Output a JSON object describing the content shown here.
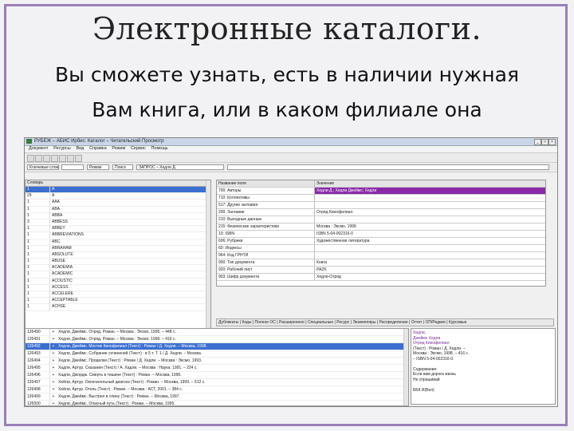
{
  "slide": {
    "title": "Электронные каталоги.",
    "subtitle": "Вы сможете узнать, есть в наличии нужная Вам книга, или в каком филиале она находится."
  },
  "app": {
    "window_title": "РУБЕЖ – АБИС Ирбис: Каталог – Читательский Просмотр",
    "menu": [
      "Документ",
      "Ресурсы",
      "Вид",
      "Справка",
      "Режим",
      "Сервис",
      "Помощь"
    ],
    "search": {
      "field1": "Ключевые слова",
      "field2": "",
      "field3": "Режим",
      "field4": "Поиск",
      "field5": "ЗАПРОС – Хедли Д.",
      "field6": ""
    },
    "left_list": {
      "header_term": "Словарь",
      "rows": [
        {
          "n": "1",
          "t": "A",
          "selected": true
        },
        {
          "n": "29",
          "t": "A"
        },
        {
          "n": "1",
          "t": "AAA"
        },
        {
          "n": "1",
          "t": "ABA"
        },
        {
          "n": "1",
          "t": "ABBA"
        },
        {
          "n": "3",
          "t": "ABBESS"
        },
        {
          "n": "1",
          "t": "ABBEY"
        },
        {
          "n": "1",
          "t": "ABBREVIATIONS"
        },
        {
          "n": "1",
          "t": "ABC"
        },
        {
          "n": "1",
          "t": "ABRAHAM"
        },
        {
          "n": "1",
          "t": "ABSOLUTE"
        },
        {
          "n": "1",
          "t": "ABUSE"
        },
        {
          "n": "1",
          "t": "ACADEMIA"
        },
        {
          "n": "1",
          "t": "ACADEMIC"
        },
        {
          "n": "1",
          "t": "ACOUSTIC"
        },
        {
          "n": "1",
          "t": "ACCESS"
        },
        {
          "n": "1",
          "t": "ACCELERE"
        },
        {
          "n": "1",
          "t": "ACCEPTABLE"
        },
        {
          "n": "1",
          "t": "ACHSE"
        }
      ]
    },
    "detail": {
      "header_key": "Название поля",
      "header_value": "Значение",
      "rows": [
        {
          "k": "700: Авторы",
          "v": "Хедли Д.; Хедли Джеймс; Хедли",
          "hl": true
        },
        {
          "k": "710: Коллективы",
          "v": ""
        },
        {
          "k": "517: Другие заглавия",
          "v": ""
        },
        {
          "k": "200: Заглавие",
          "v": "Отряд Кинофилиал"
        },
        {
          "k": "210: Выходные данные",
          "v": ""
        },
        {
          "k": "215: Физические характеристики",
          "v": "Москва : Эксмо, 1999"
        },
        {
          "k": "10: ISBN",
          "v": "ISBN 5-04-002316-0"
        },
        {
          "k": "606: Рубрики",
          "v": "Художественная литература"
        },
        {
          "k": "60: Индексы",
          "v": ""
        },
        {
          "k": "964: Код ГРНТИ",
          "v": ""
        },
        {
          "k": "900: Тип документа",
          "v": "Книга"
        },
        {
          "k": "920: Рабочий лист",
          "v": "PAZK"
        },
        {
          "k": "903: Шифр документа",
          "v": "Хедли-Отряд"
        }
      ]
    },
    "tabs": "Дубликаты | Коды | Полное ОС | Расширенное | Специальные | Ресурс | Экземпляры | Распределение | Отчет | ОП/Редкие | Курсовые",
    "bottom_list": {
      "rows": [
        {
          "n": "126490",
          "d": "Хедли, Джеймс. Отряд. Роман. – Москва : Эксмо, 1995. – 448 с."
        },
        {
          "n": "126491",
          "d": "Хедли, Джеймс. Отряд. Роман. – Москва : Эксмо, 1999. – 416 с."
        },
        {
          "n": "126492",
          "d": "Хедли, Джеймс. Мостик Кинофилиал (Текст) : Роман / Д. Хедли. – Москва, 1998.",
          "selected": true
        },
        {
          "n": "126493",
          "d": "Хедли, Джеймс. Собрание сочинений (Текст) : в 5 т. Т. 1 / Д. Хедли. – Москва."
        },
        {
          "n": "126494",
          "d": "Хедли, Джеймс. Проделки (Текст) : Роман / Д. Хедли. – Москва : Эксмо, 1993."
        },
        {
          "n": "126495",
          "d": "Хадли, Артур. Сказания (Текст) / А. Хадли. – Москва : Наука, 1991. – 224 с."
        },
        {
          "n": "126496",
          "d": "Хадли, Джордж. Смерть в тишине (Текст) : Роман. – Москва, 1996."
        },
        {
          "n": "126497",
          "d": "Хейли, Артур. Окончательный диагноз (Текст) : Роман. – Москва, 1999. – 512 с."
        },
        {
          "n": "126498",
          "d": "Хейли, Артур. Отель (Текст) : Роман. – Москва : АСТ, 2001. – 384 с."
        },
        {
          "n": "126499",
          "d": "Хедли, Джеймс. Выстрел в спину (Текст) : Роман. – Москва, 1997."
        },
        {
          "n": "126500",
          "d": "Хедли, Джеймс. Опасный путь (Текст) : Роман. – Москва, 1995."
        },
        {
          "n": "126501",
          "d": "Хейли, Артур. Аэропорт (Текст) : Роман. – Москва, 1998. – 384 с."
        }
      ]
    },
    "card_lines": [
      "Хедли,",
      "Джеймс Хедли",
      "Отряд Кинофилиал",
      "(Текст) : Роман / Д. Хедли. –",
      "Москва : Эксмо, 1998. – 416 с.",
      "– ISBN 5-04-002316-0.",
      "",
      "Содержание:",
      "Если вам дорога жизнь",
      "Не спрашивай",
      "",
      "ББК И(Вел)"
    ]
  }
}
